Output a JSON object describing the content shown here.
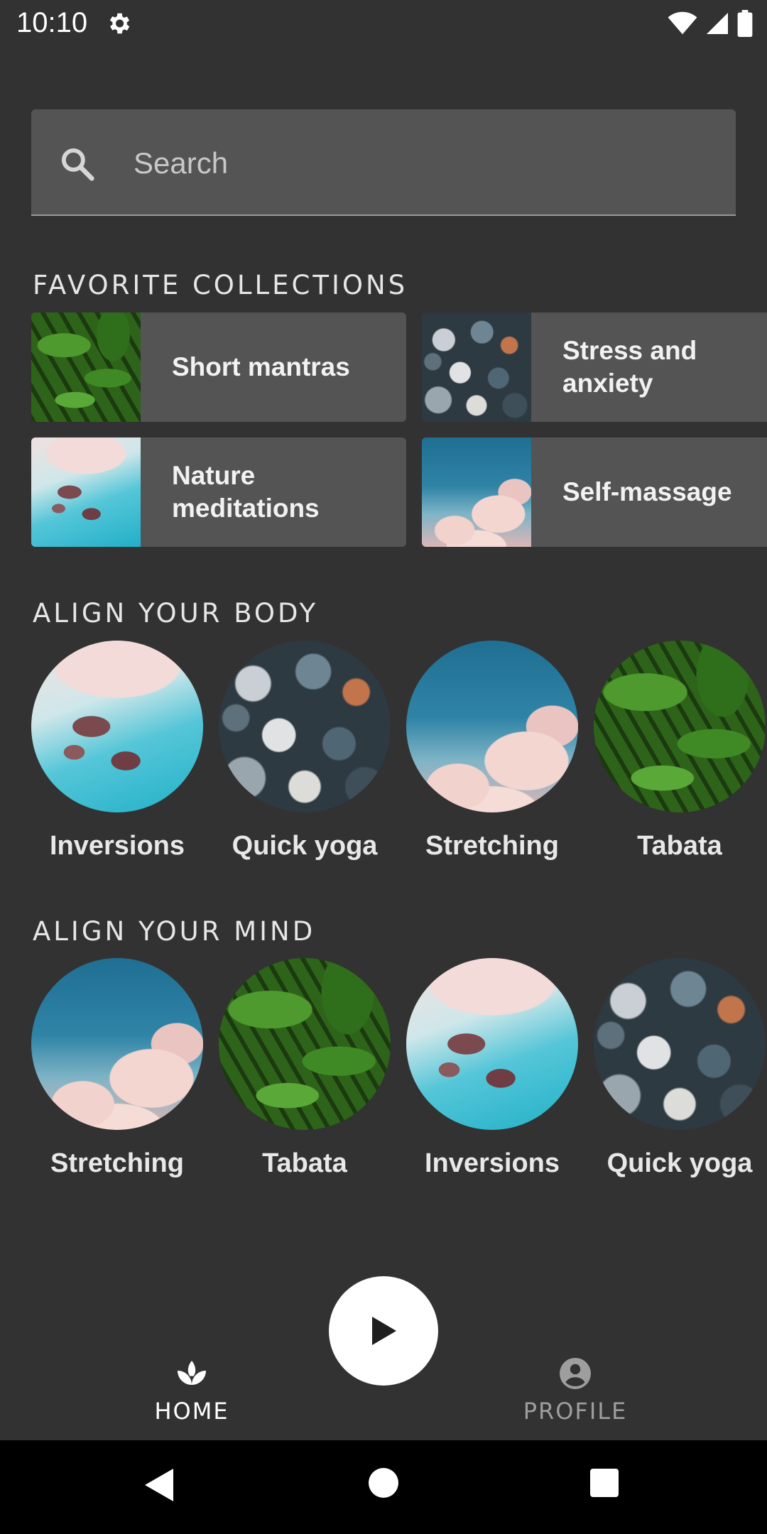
{
  "status_bar": {
    "time": "10:10",
    "icons": [
      "gear-icon",
      "wifi-icon",
      "signal-icon",
      "battery-icon"
    ]
  },
  "search": {
    "placeholder": "Search",
    "value": ""
  },
  "favorite_collections": {
    "title": "FAVORITE COLLECTIONS",
    "items": [
      {
        "label": "Short mantras",
        "image": "tropical-leaves"
      },
      {
        "label": "Stress and anxiety",
        "image": "pebbles"
      },
      {
        "label": "Nature meditations",
        "image": "aerial-shore"
      },
      {
        "label": "Self-massage",
        "image": "clouds"
      }
    ]
  },
  "align_body": {
    "title": "ALIGN YOUR BODY",
    "items": [
      {
        "label": "Inversions",
        "image": "aerial-shore"
      },
      {
        "label": "Quick yoga",
        "image": "pebbles"
      },
      {
        "label": "Stretching",
        "image": "clouds"
      },
      {
        "label": "Tabata",
        "image": "tropical-leaves"
      }
    ]
  },
  "align_mind": {
    "title": "ALIGN YOUR MIND",
    "items": [
      {
        "label": "Stretching",
        "image": "clouds"
      },
      {
        "label": "Tabata",
        "image": "tropical-leaves"
      },
      {
        "label": "Inversions",
        "image": "aerial-shore"
      },
      {
        "label": "Quick yoga",
        "image": "pebbles"
      }
    ]
  },
  "bottom_nav": {
    "play_icon": "play-icon",
    "home": {
      "label": "HOME",
      "icon": "lotus-icon",
      "selected": true
    },
    "profile": {
      "label": "PROFILE",
      "icon": "account-circle-icon",
      "selected": false
    }
  },
  "colors": {
    "background": "#323232",
    "card": "#545454",
    "text": "#ffffff",
    "nav_inactive": "#9e9e9e"
  }
}
